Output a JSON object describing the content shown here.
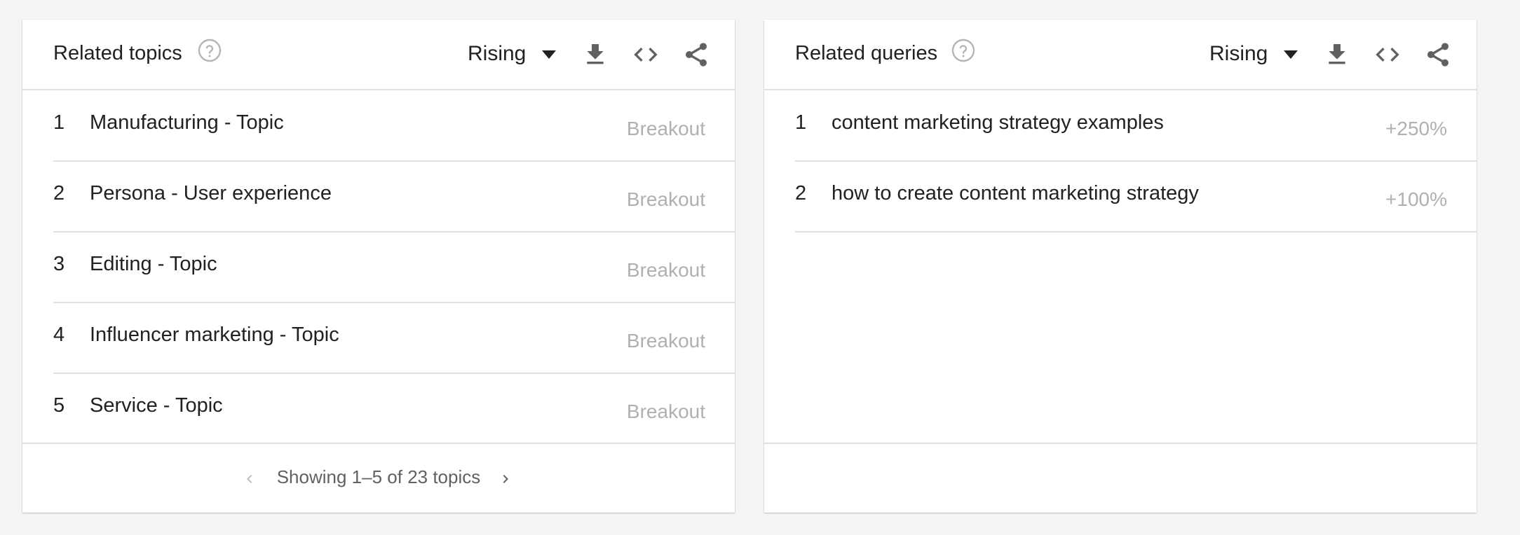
{
  "topics_card": {
    "title": "Related topics",
    "filter_label": "Rising",
    "rows": [
      {
        "index": "1",
        "label": "Manufacturing - Topic",
        "value": "Breakout"
      },
      {
        "index": "2",
        "label": "Persona - User experience",
        "value": "Breakout"
      },
      {
        "index": "3",
        "label": "Editing - Topic",
        "value": "Breakout"
      },
      {
        "index": "4",
        "label": "Influencer marketing - Topic",
        "value": "Breakout"
      },
      {
        "index": "5",
        "label": "Service - Topic",
        "value": "Breakout"
      }
    ],
    "pagination_text": "Showing 1–5 of 23 topics"
  },
  "queries_card": {
    "title": "Related queries",
    "filter_label": "Rising",
    "rows": [
      {
        "index": "1",
        "label": "content marketing strategy examples",
        "value": "+250%"
      },
      {
        "index": "2",
        "label": "how to create content marketing strategy",
        "value": "+100%"
      }
    ]
  },
  "icons": {
    "help": "help-circle-icon",
    "dropdown": "arrow-drop-down-icon",
    "download": "download-icon",
    "embed": "code-icon",
    "share": "share-icon",
    "prev": "chevron-left-icon",
    "next": "chevron-right-icon"
  },
  "colors": {
    "background": "#f5f5f5",
    "card": "#ffffff",
    "text": "#212121",
    "muted_value": "#b0b0b0",
    "icon": "#616161",
    "divider": "#e0e0e0"
  }
}
